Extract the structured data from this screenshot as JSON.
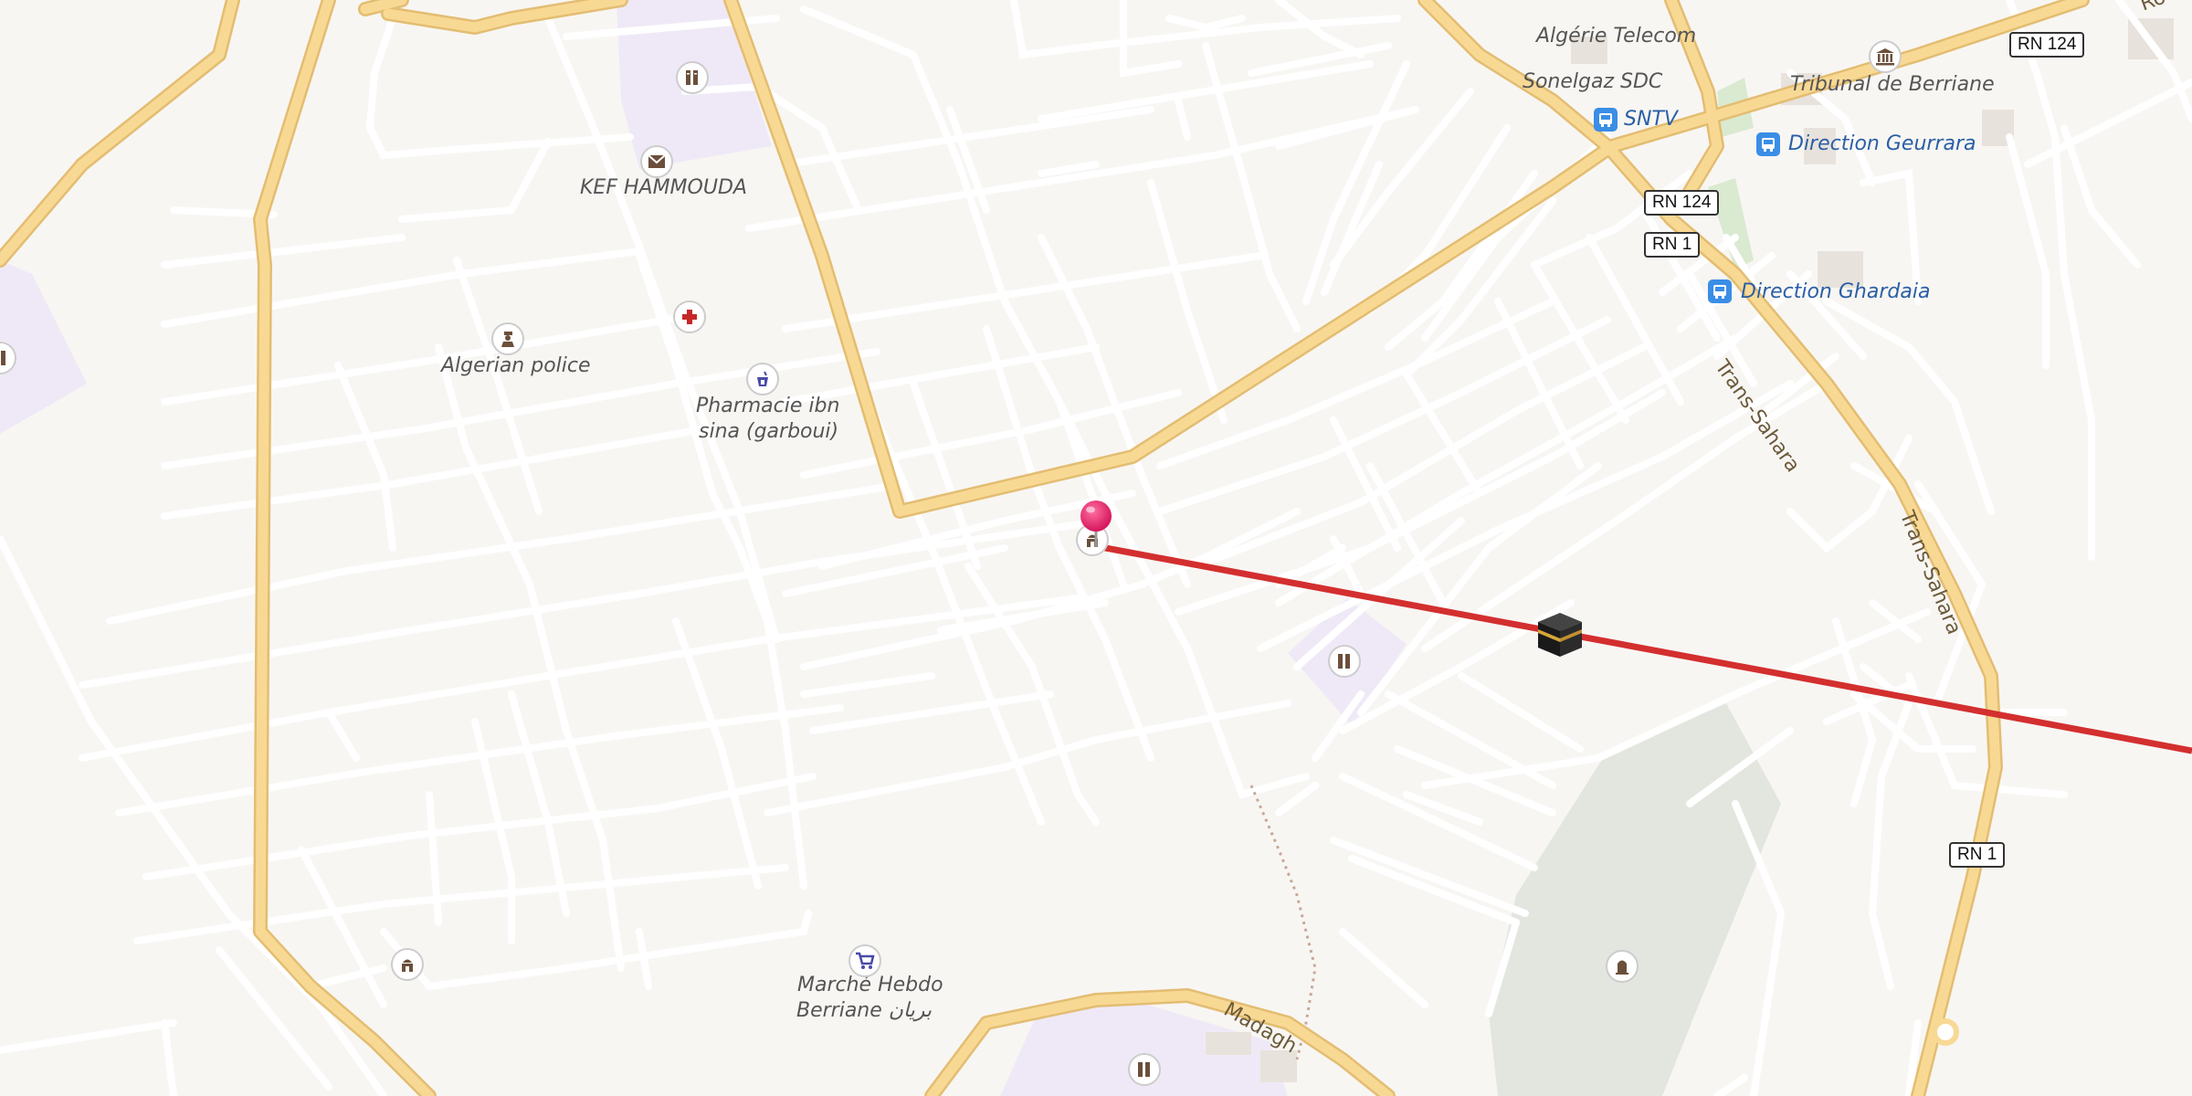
{
  "map": {
    "labels": {
      "kef_hammouda": "KEF HAMMOUDA",
      "algerian_police": "Algerian police",
      "pharmacie_1": "Pharmacie ibn",
      "pharmacie_2": "sina (garboui)",
      "algerie_telecom": "Algérie Telecom",
      "sonelgaz": "Sonelgaz SDC",
      "sntv": "SNTV",
      "tribunal": "Tribunal de Berriane",
      "direction_geurrara": "Direction Geurrara",
      "direction_ghardaia": "Direction Ghardaia",
      "marche_1": "Marché Hebdo",
      "marche_2": "Berriane بريان",
      "trans_sahara_1": "Trans-Sahara",
      "trans_sahara_2": "Trans-Sahara",
      "madagh": "Madagh",
      "ro_partial": "Ro"
    },
    "shields": {
      "rn124_top": "RN 124",
      "rn124_mid": "RN 124",
      "rn1_mid": "RN 1",
      "rn1_low": "RN 1"
    },
    "colors": {
      "background": "#f8f6f3",
      "minor_road": "#ffffff",
      "major_road": "#f8d994",
      "major_road_casing": "#e8c27a",
      "route_line": "#d32f2f",
      "pin": "#e91e63",
      "landuse_purple": "#efe9f7",
      "park_green": "#e2e6df"
    },
    "icons": [
      "school-icon",
      "post-office-icon",
      "police-icon",
      "hospital-icon",
      "pharmacy-icon",
      "monument-icon",
      "bus-stop-icon",
      "mosque-icon",
      "shopping-cart-icon",
      "religious-icon",
      "cemetery-icon",
      "map-pin-icon"
    ]
  }
}
